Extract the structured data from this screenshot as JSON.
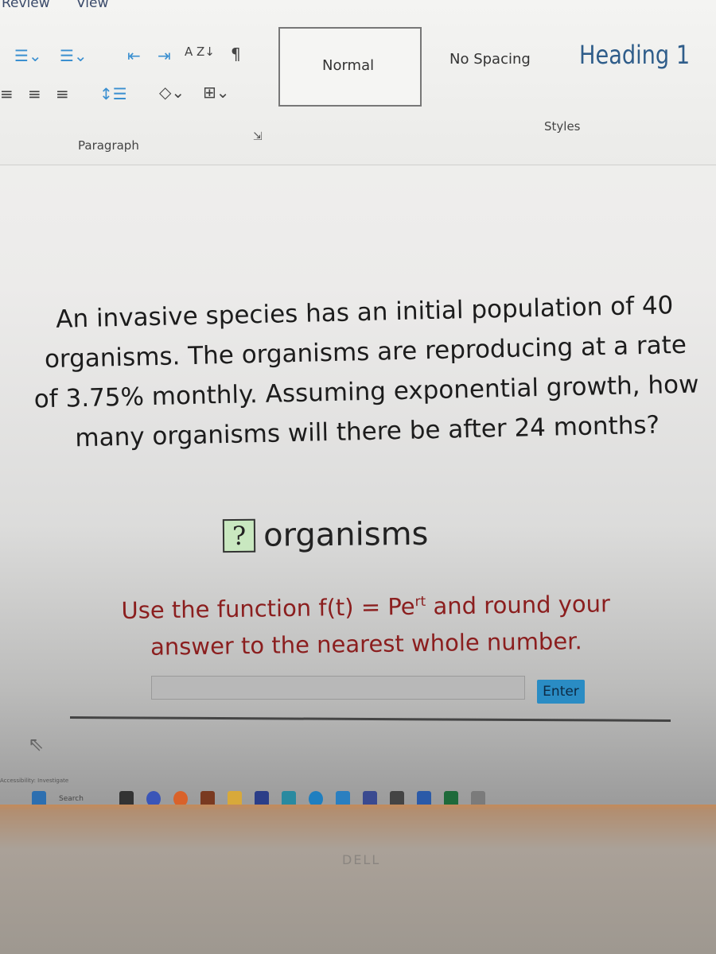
{
  "menu": {
    "review": "Review",
    "view": "View"
  },
  "ribbon": {
    "paragraph_label": "Paragraph",
    "styles_label": "Styles",
    "sort_glyph": "A Z↓",
    "pilcrow": "¶",
    "styles": [
      {
        "label": "Normal"
      },
      {
        "label": "No Spacing"
      },
      {
        "label": "Heading 1"
      }
    ]
  },
  "question": {
    "text": "An invasive species has an initial population of 40 organisms. The organisms are reproducing at a rate of 3.75% monthly. Assuming exponential growth, how many organisms will there be after 24 months?"
  },
  "answer": {
    "blank": "?",
    "unit": "organisms"
  },
  "hint": {
    "text": "Use the function f(t) = Pe",
    "sup": "rt",
    "text2": " and round your answer to the nearest whole number."
  },
  "input": {
    "value": "",
    "enter_label": "Enter"
  },
  "taskbar": {
    "search": "Search",
    "status": "Accessibility: Investigate"
  },
  "bezel": {
    "brand": "DELL"
  },
  "colors": {
    "answer_box": "#c9e8c0",
    "hint": "#8b1e1e",
    "enter": "#2a8cc4"
  }
}
